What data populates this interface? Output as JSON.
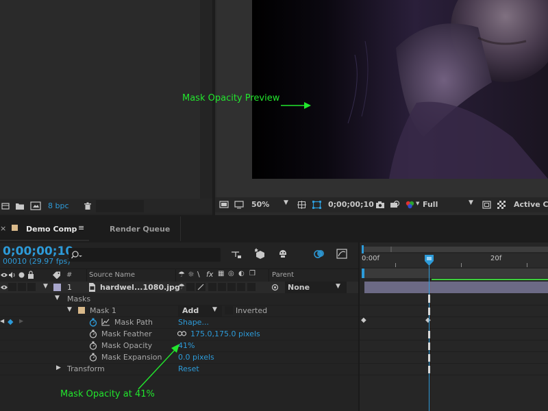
{
  "project_panel": {
    "bpc": "8 bpc"
  },
  "viewer": {
    "annotation": "Mask Opacity Preview",
    "zoom": "50%",
    "timecode": "0;00;00;10",
    "resolution": "Full",
    "camera": "Active Ca"
  },
  "tabs": [
    {
      "label": "Demo Comp"
    },
    {
      "label": "Render Queue"
    }
  ],
  "timeline": {
    "timecode": "0;00;00;10",
    "frame_info": "00010 (29.97 fps)",
    "col_number": "#",
    "col_source": "Source Name",
    "col_parent": "Parent",
    "ruler_start": "0:00f",
    "ruler_20f": "20f"
  },
  "layer": {
    "number": "1",
    "name": "hardwel...1080.jpg",
    "parent": "None"
  },
  "masks": {
    "group_label": "Masks",
    "mask_name": "Mask 1",
    "mode": "Add",
    "inverted_label": "Inverted",
    "properties": [
      {
        "label": "Mask Path",
        "value": "Shape..."
      },
      {
        "label": "Mask Feather",
        "value": "175.0,175.0 pixels"
      },
      {
        "label": "Mask Opacity",
        "value": "41%"
      },
      {
        "label": "Mask Expansion",
        "value": "0.0 pixels"
      }
    ],
    "transform_label": "Transform",
    "transform_value": "Reset"
  },
  "annotation_bottom": "Mask Opacity at 41%",
  "colors": {
    "accent_blue": "#2d9bd9",
    "annotation_green": "#22e52d",
    "layer_label": "#a8a6cc",
    "mask_label": "#d9b98a"
  }
}
